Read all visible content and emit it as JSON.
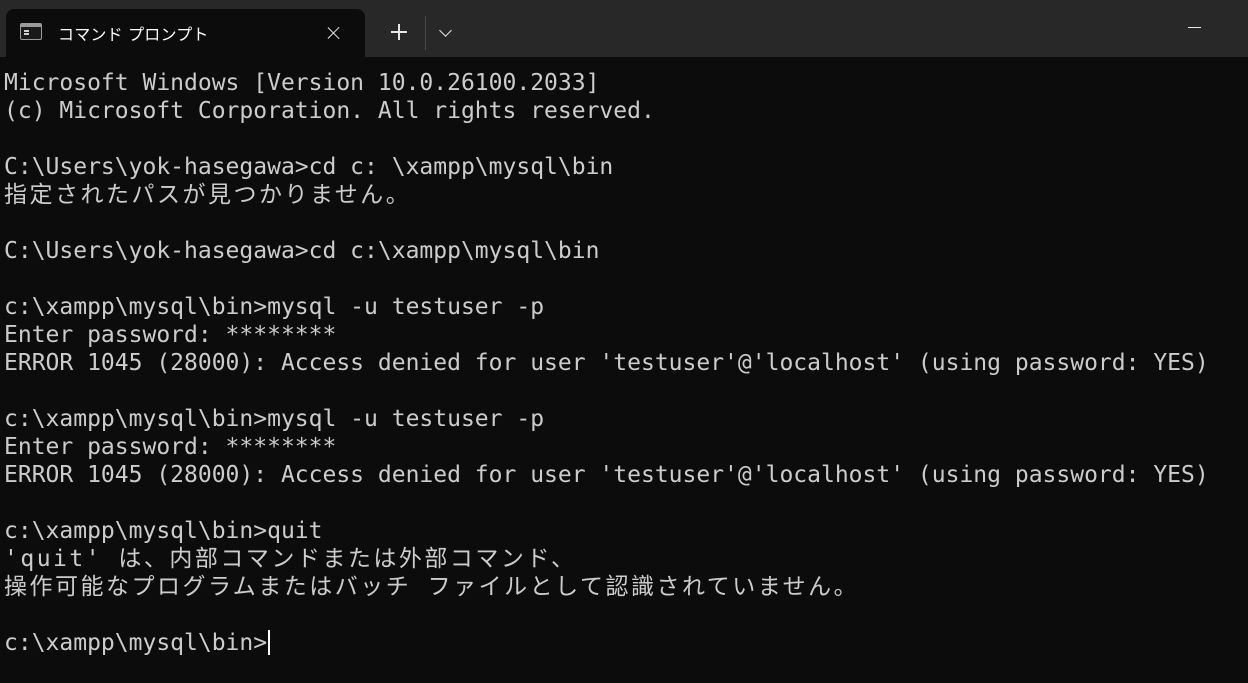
{
  "tab": {
    "icon": "console-icon",
    "title": "コマンド プロンプト"
  },
  "tab_strip": {
    "new_tab_icon": "plus-icon",
    "dropdown_icon": "chevron-down-icon"
  },
  "window_controls": {
    "minimize_icon": "minimize-icon"
  },
  "console": {
    "lines": [
      "Microsoft Windows [Version 10.0.26100.2033]",
      "(c) Microsoft Corporation. All rights reserved.",
      "",
      "C:\\Users\\yok-hasegawa>cd c: \\xampp\\mysql\\bin",
      "指定されたパスが見つかりません。",
      "",
      "C:\\Users\\yok-hasegawa>cd c:\\xampp\\mysql\\bin",
      "",
      "c:\\xampp\\mysql\\bin>mysql -u testuser -p",
      "Enter password: ********",
      "ERROR 1045 (28000): Access denied for user 'testuser'@'localhost' (using password: YES)",
      "",
      "c:\\xampp\\mysql\\bin>mysql -u testuser -p",
      "Enter password: ********",
      "ERROR 1045 (28000): Access denied for user 'testuser'@'localhost' (using password: YES)",
      "",
      "c:\\xampp\\mysql\\bin>quit",
      "'quit' は、内部コマンドまたは外部コマンド、",
      "操作可能なプログラムまたはバッチ ファイルとして認識されていません。",
      "",
      "c:\\xampp\\mysql\\bin>"
    ]
  },
  "colors": {
    "background": "#0c0c0c",
    "titlebar": "#282828",
    "text": "#cccccc"
  }
}
